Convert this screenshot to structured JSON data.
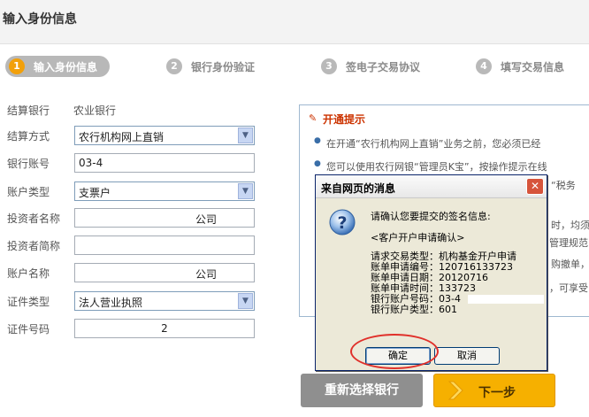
{
  "header": {
    "title": "输入身份信息"
  },
  "steps": [
    {
      "num": "1",
      "label": "输入身份信息",
      "active": true
    },
    {
      "num": "2",
      "label": "银行身份验证",
      "active": false
    },
    {
      "num": "3",
      "label": "签电子交易协议",
      "active": false
    },
    {
      "num": "4",
      "label": "填写交易信息",
      "active": false
    }
  ],
  "form": {
    "settle_bank": {
      "label": "结算银行",
      "value": "农业银行"
    },
    "settle_method": {
      "label": "结算方式",
      "value": "农行机构网上直销"
    },
    "bank_account": {
      "label": "银行账号",
      "value": "03-4"
    },
    "account_type": {
      "label": "账户类型",
      "value": "支票户"
    },
    "investor_name": {
      "label": "投资者名称",
      "value": "公司"
    },
    "investor_short": {
      "label": "投资者简称",
      "value": ""
    },
    "account_name": {
      "label": "账户名称",
      "value": "公司"
    },
    "id_type": {
      "label": "证件类型",
      "value": "法人营业执照"
    },
    "id_number": {
      "label": "证件号码",
      "value": "2"
    }
  },
  "tips": {
    "title": "开通提示",
    "line1": "在开通“农行机构网上直销”业务之前，您必须已经",
    "line2": "您可以使用农行网银“管理员K宝”，按操作提示在线",
    "frag1": "“税务",
    "frag2": "时，均须",
    "frag3": "管理规范",
    "frag4": "购撤单，",
    "frag5": "，可享受"
  },
  "dialog": {
    "title": "来自网页的消息",
    "close": "✕",
    "confirm_msg": "请确认您要提交的签名信息:",
    "subtitle": "<客户开户申请确认>",
    "details": [
      "请求交易类型：机构基金开户申请",
      "账单申请编号：120716133723",
      "账单申请日期：20120716",
      "账单申请时间：133723",
      "银行账户号码：03-4",
      "银行账户类型：601"
    ],
    "ok_label": "确定",
    "cancel_label": "取消"
  },
  "buttons": {
    "reselect": "重新选择银行",
    "next": "下一步"
  },
  "colors": {
    "accent_orange": "#f6b000",
    "tip_red": "#cc3300",
    "ring_red": "#e0302a"
  }
}
